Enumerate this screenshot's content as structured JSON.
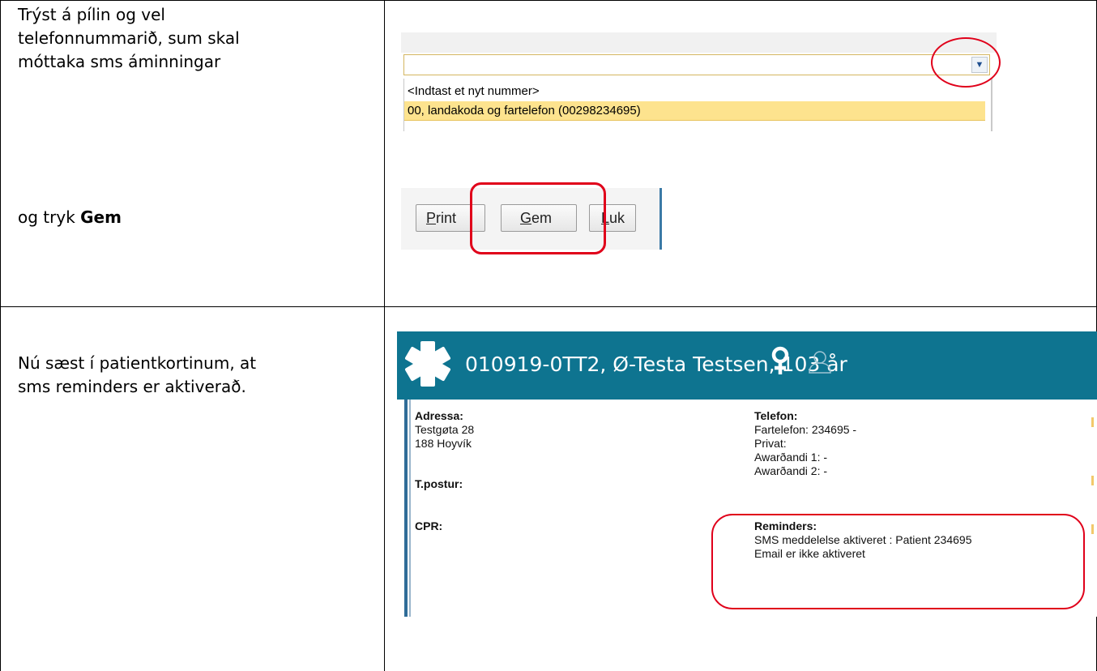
{
  "rows": [
    {
      "instruction_lines": [
        "Trýst á pílin og vel",
        "telefonnummarið, sum skal",
        "móttaka sms áminningar"
      ],
      "dropdown": {
        "options": [
          "<Indtast et nyt nummer>",
          "00, landakoda og fartelefon (00298234695)"
        ],
        "selected_index": 1,
        "arrow_glyph": "▼"
      },
      "instruction2_prefix": "og tryk",
      "instruction2_bold": "Gem",
      "buttons": {
        "print": "Print",
        "gem": "Gem",
        "luk": "Luk"
      }
    },
    {
      "instruction_lines": [
        "Nú sæst í patientkortinum, at",
        "sms reminders er aktiverað."
      ],
      "patient_card": {
        "header_title": "010919-0TT2, Ø-Testa Testsen, 103 år",
        "header_color": "#0e7490",
        "icons": [
          "star-of-life-logo-icon",
          "female-icon",
          "person-icon"
        ],
        "address_label": "Adressa:",
        "address_lines": [
          "Testgøta 28",
          "188 Hoyvík"
        ],
        "email_label": "T.postur:",
        "cpr_label": "CPR:",
        "phone_label": "Telefon:",
        "phone_lines": [
          "Fartelefon: 234695 -",
          "Privat:",
          "Awarðandi 1: -",
          "Awarðandi 2: -"
        ],
        "reminders_label": "Reminders:",
        "reminders_lines": [
          "SMS meddelelse aktiveret : Patient 234695",
          "Email er ikke aktiveret"
        ]
      }
    }
  ],
  "highlight_color": "#e0001a"
}
